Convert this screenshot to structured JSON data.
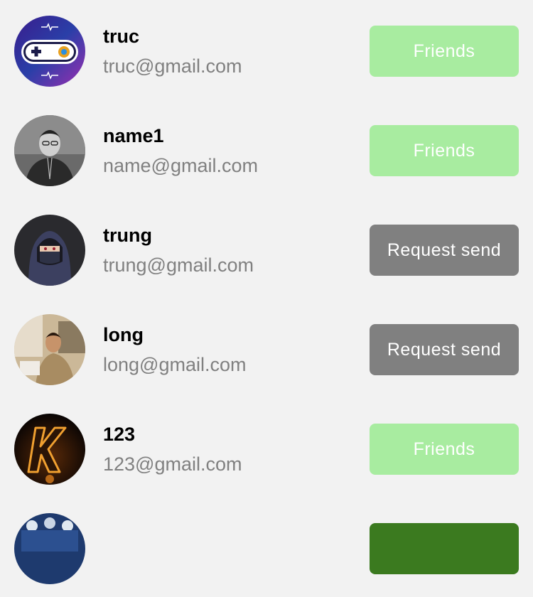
{
  "users": [
    {
      "name": "truc",
      "email": "truc@gmail.com",
      "button": "Friends",
      "status": "friends",
      "avatar_icon": "gamepad-avatar"
    },
    {
      "name": "name1",
      "email": "name@gmail.com",
      "button": "Friends",
      "status": "friends",
      "avatar_icon": "person-photo-avatar"
    },
    {
      "name": "trung",
      "email": "trung@gmail.com",
      "button": "Request send",
      "status": "request",
      "avatar_icon": "hooded-ninja-avatar"
    },
    {
      "name": "long",
      "email": "long@gmail.com",
      "button": "Request send",
      "status": "request",
      "avatar_icon": "person-photo-avatar"
    },
    {
      "name": "123",
      "email": "123@gmail.com",
      "button": "Friends",
      "status": "friends",
      "avatar_icon": "letter-k-avatar"
    },
    {
      "name": "",
      "email": "",
      "button": "",
      "status": "add",
      "avatar_icon": "crowd-photo-avatar"
    }
  ],
  "colors": {
    "background": "#f2f2f2",
    "friends_button": "#a8eca0",
    "request_button": "#808080",
    "add_button": "#3b7a1f",
    "email_text": "#808080"
  }
}
